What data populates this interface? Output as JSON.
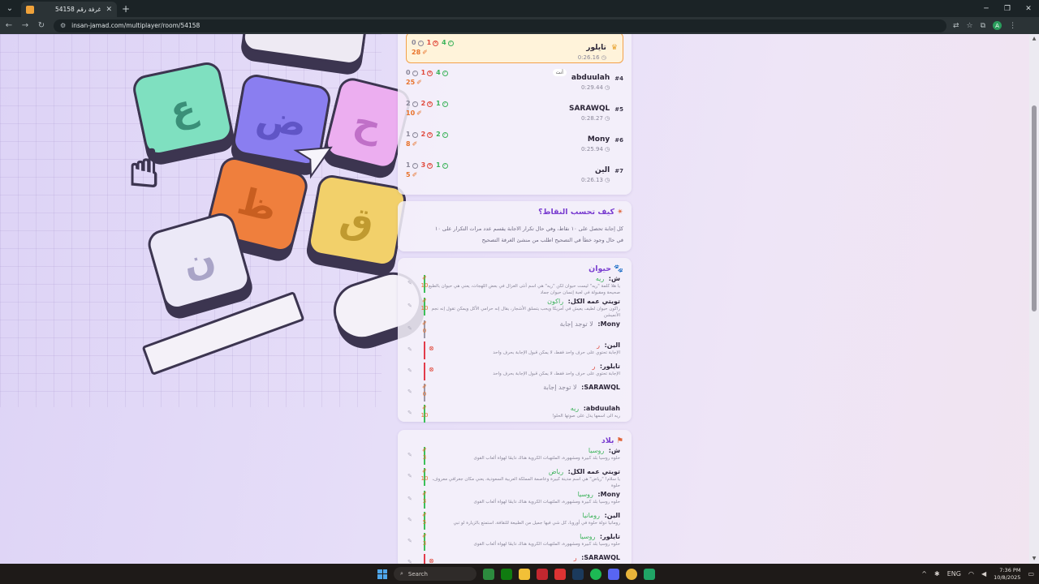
{
  "browser": {
    "tab_title": "غرفة رقم 54158",
    "url": "insan-jamad.com/multiplayer/room/54158"
  },
  "players": [
    {
      "rank": "",
      "name": "تايلور",
      "time": "0:26.16",
      "gray": "0",
      "red": "1",
      "green": "4",
      "points": "28",
      "highlight": true
    },
    {
      "rank": "#4",
      "name": "abduulah",
      "you_label": "أنت",
      "time": "0:29.44",
      "gray": "0",
      "red": "1",
      "green": "4",
      "points": "25"
    },
    {
      "rank": "#5",
      "name": "SARAWQL",
      "time": "0:28.27",
      "gray": "2",
      "red": "2",
      "green": "1",
      "points": "10"
    },
    {
      "rank": "#6",
      "name": "Mony",
      "time": "0:25.94",
      "gray": "1",
      "red": "2",
      "green": "2",
      "points": "8"
    },
    {
      "rank": "#7",
      "name": "الين",
      "time": "0:26.13",
      "gray": "1",
      "red": "3",
      "green": "1",
      "points": "5"
    }
  ],
  "howto": {
    "title": "كيف تحسب النقاط؟",
    "line1": "كل إجابة تحصل على ١٠ نقاط، وفي حال تكرار الاجابة يقسم عدد مرات التكرار على ١٠",
    "line2": "في حال وجود خطأ في التصحيح اطلب من منشئ الغرفة التصحيح"
  },
  "category1": {
    "title": "حيوان",
    "answers": [
      {
        "who": "ش:",
        "word": "ريه",
        "desc": "يا هلا كلمة \"ريه\" ليست حيوان لكن \"ريه\" هي اسم أنثى الغزال في بعض اللهجات، يعني هي حيوان بالطبع صحيحة ومقبولة في لعبة إنسان حيوان جماد",
        "score": "10",
        "status": "ok"
      },
      {
        "who": "تويتي عمه الكل:",
        "word": "راكون",
        "desc": "راكون حيوان لطيف يعيش في أمريكا ويحب يتسلق الأشجار، يقال إنه حرامي الأكل ويمكن تقول إنه نجم الأنميشن",
        "score": "10",
        "status": "ok"
      },
      {
        "who": "Mony:",
        "word": "لا توجد إجابة",
        "desc": "",
        "score": "0",
        "status": "none"
      },
      {
        "who": "الين:",
        "word": "ر",
        "desc": "الإجابة تحتوي على حرف واحد فقط، لا يمكن قبول الإجابة بحرف واحد",
        "score": "",
        "status": "bad"
      },
      {
        "who": "تايلور:",
        "word": "ر",
        "desc": "الإجابة تحتوي على حرف واحد فقط، لا يمكن قبول الإجابة بحرف واحد",
        "score": "",
        "status": "bad"
      },
      {
        "who": "SARAWQL:",
        "word": "لا توجد إجابة",
        "desc": "",
        "score": "0",
        "status": "none"
      },
      {
        "who": "abduulah:",
        "word": "ريه",
        "desc": "ريه الى اسمها يدل على صوتها الحلو!",
        "score": "10",
        "status": "ok"
      }
    ]
  },
  "category2": {
    "title": "بلاد",
    "answers": [
      {
        "who": "ش:",
        "word": "روسيا",
        "desc": "حلوه روسيا بلد كبيرة ومشهورة، الملتهبات الكروية هناك دايمًا لهواة ألعاب القوى",
        "score": "3",
        "status": "ok"
      },
      {
        "who": "تويتي عمه الكل:",
        "word": "رياض",
        "desc": "يا سلام! \"رياض\" هي اسم مدينة كبيرة وعاصمة المملكة العربية السعودية، يعني مكان جغرافي معروف، حلوة",
        "score": "10",
        "status": "ok"
      },
      {
        "who": "Mony:",
        "word": "روسيا",
        "desc": "حلوه روسيا بلد كبيرة ومشهورة، الملتهبات الكروية هناك دايمًا لهواة ألعاب القوى",
        "score": "3",
        "status": "ok"
      },
      {
        "who": "الين:",
        "word": "رومانيا",
        "desc": "رومانيا دولة حلوة في أوروبا، كل شي فيها جميل من الطبيعة للثقافة، استمتع بالزيارة لو تبي",
        "score": "5",
        "status": "ok"
      },
      {
        "who": "تايلور:",
        "word": "روسيا",
        "desc": "حلوه روسيا بلد كبيرة ومشهورة، الملتهبات الكروية هناك دايمًا لهواة ألعاب القوى",
        "score": "3",
        "status": "ok"
      },
      {
        "who": "SARAWQL:",
        "word": "ر",
        "desc": "",
        "score": "",
        "status": "bad"
      }
    ]
  },
  "taskbar": {
    "search_placeholder": "Search",
    "time": "7:36 PM",
    "date": "10/8/2025",
    "lang": "ENG"
  },
  "keys": [
    "ع",
    "ض",
    "ح",
    "ظ",
    "ق",
    "ن"
  ],
  "colors": {
    "accent": "#7a3ed0",
    "correct": "#3cb35a",
    "wrong": "#e0483a",
    "points": "#e8732c",
    "highlight_border": "#f2a14a"
  }
}
